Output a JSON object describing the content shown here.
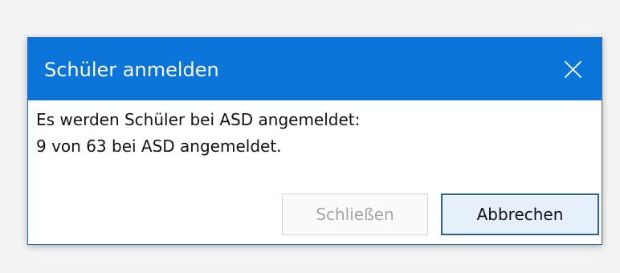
{
  "dialog": {
    "title": "Schüler anmelden",
    "close_icon": "close-icon",
    "message": [
      "Es werden Schüler bei ASD angemeldet:",
      "9 von 63 bei ASD angemeldet."
    ],
    "buttons": {
      "close": "Schließen",
      "cancel": "Abbrechen"
    },
    "colors": {
      "titlebar": "#0a74d9",
      "border": "#2b6cb8",
      "disabled_text": "#a5a5a5",
      "cancel_border": "#1d5fa8",
      "cancel_background": "#e6f0fb"
    }
  }
}
